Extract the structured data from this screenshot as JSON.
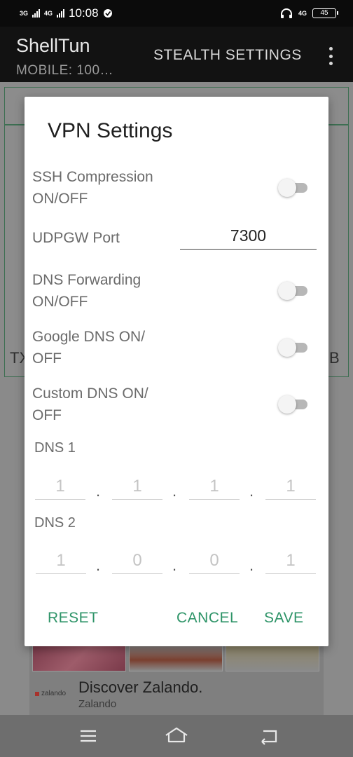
{
  "status_bar": {
    "network_left_1": "3G",
    "network_left_2": "4G",
    "time": "10:08",
    "network_right": "4G",
    "battery": "45"
  },
  "app_bar": {
    "title": "ShellTun",
    "subtitle": "MOBILE: 100…",
    "action": "STEALTH SETTINGS"
  },
  "background": {
    "left_text": "TX",
    "right_text": "B",
    "ad": {
      "brand": "zalando",
      "title": "Discover Zalando.",
      "subtitle": "Zalando"
    }
  },
  "dialog": {
    "title": "VPN Settings",
    "ssh_compression": {
      "label": "SSH Compression ON/OFF",
      "on": false
    },
    "udpgw": {
      "label": "UDPGW Port",
      "value": "7300"
    },
    "dns_forwarding": {
      "label": "DNS Forwarding ON/OFF",
      "on": false
    },
    "google_dns": {
      "label": "Google DNS ON/ OFF",
      "on": false
    },
    "custom_dns": {
      "label": "Custom DNS ON/ OFF",
      "on": false
    },
    "dns1": {
      "label": "DNS 1",
      "octets": [
        "1",
        "1",
        "1",
        "1"
      ]
    },
    "dns2": {
      "label": "DNS 2",
      "octets": [
        "1",
        "0",
        "0",
        "1"
      ]
    },
    "dot": ".",
    "buttons": {
      "reset": "RESET",
      "cancel": "CANCEL",
      "save": "SAVE"
    }
  },
  "colors": {
    "accent": "#2e9468",
    "dialog_bg": "#ffffff",
    "scrim": "#8a8a8a"
  }
}
